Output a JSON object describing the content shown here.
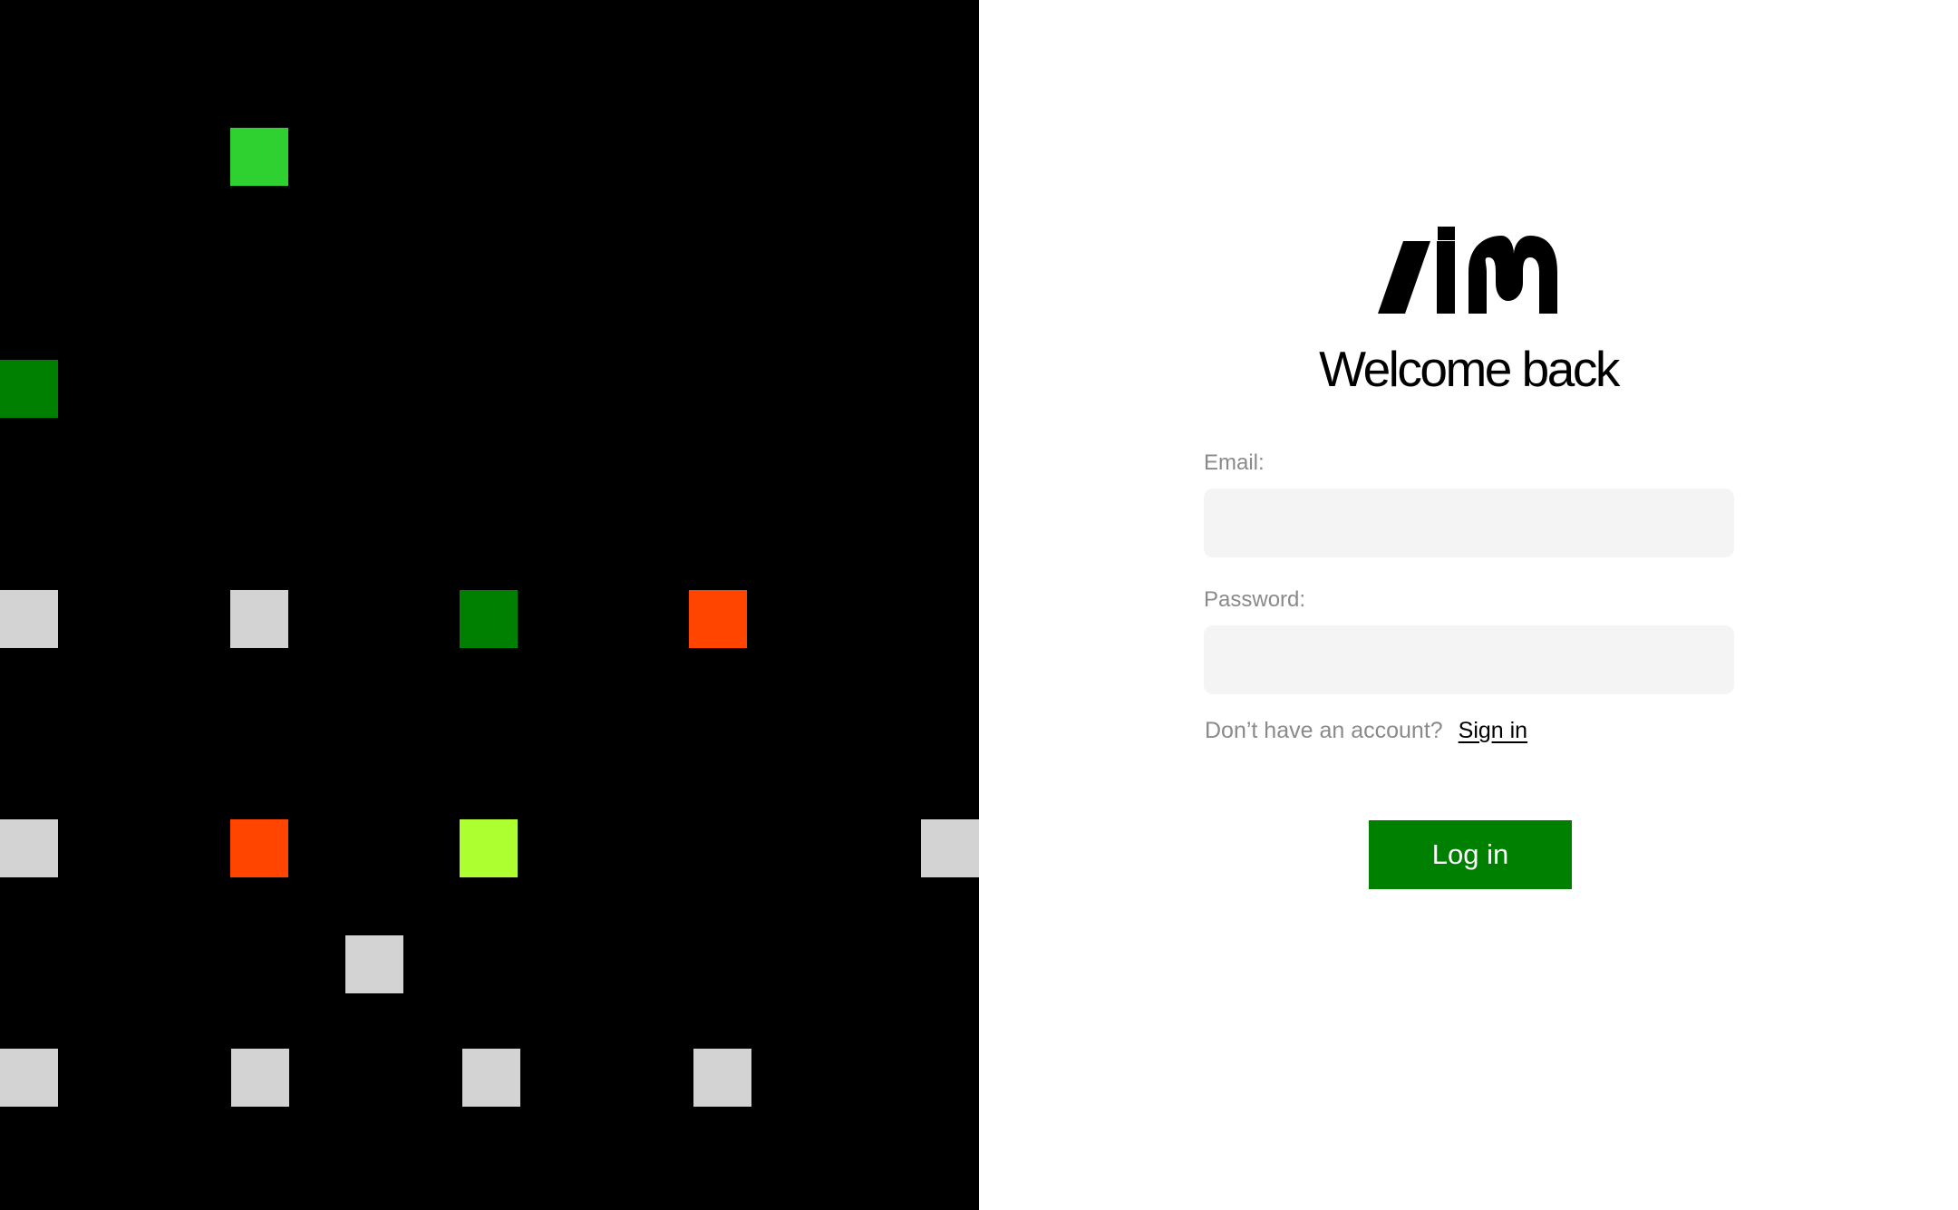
{
  "background": {
    "tile_colors": {
      "bright_green": "#2ed130",
      "green": "#008000",
      "grey": "#d3d3d3",
      "red": "#ff4500",
      "lime": "#adff2f"
    }
  },
  "brand": {
    "logo_icon": "aim-logo-icon"
  },
  "header": {
    "title": "Welcome back"
  },
  "form": {
    "email_label": "Email:",
    "email_value": "",
    "password_label": "Password:",
    "password_value": "",
    "signup_prompt": "Don’t have an account?",
    "signup_link": "Sign in",
    "submit_label": "Log in"
  },
  "colors": {
    "accent": "#008000",
    "input_background": "#f4f4f4",
    "muted_text": "#8a8a8a"
  }
}
